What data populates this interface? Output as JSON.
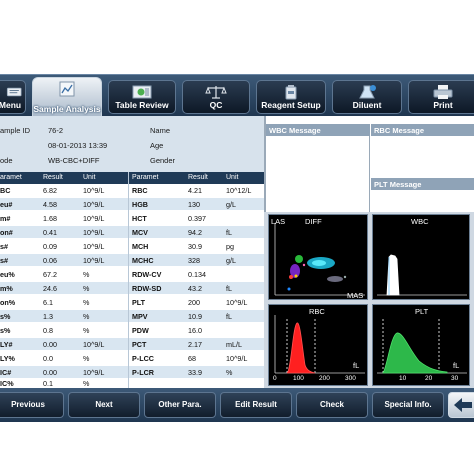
{
  "toolbar": {
    "menu": "Menu",
    "sample_analysis": "Sample Analysis",
    "table_review": "Table Review",
    "qc": "QC",
    "reagent_setup": "Reagent Setup",
    "diluent": "Diluent",
    "print": "Print"
  },
  "sample": {
    "id_label": "ample ID",
    "id_value": "76-2",
    "time_value": "08-01-2013 13:39",
    "mode_label": "ode",
    "mode_value": "WB-CBC+DIFF",
    "name_label": "Name",
    "age_label": "Age",
    "gender_label": "Gender"
  },
  "results": {
    "headers": [
      "aramet",
      "Result",
      "Unit",
      "Paramet",
      "Result",
      "Unit"
    ],
    "rows": [
      [
        "BC",
        "6.82",
        "10^9/L",
        "RBC",
        "4.21",
        "10^12/L"
      ],
      [
        "eu#",
        "4.58",
        "10^9/L",
        "HGB",
        "130",
        "g/L"
      ],
      [
        "m#",
        "1.68",
        "10^9/L",
        "HCT",
        "0.397",
        ""
      ],
      [
        "on#",
        "0.41",
        "10^9/L",
        "MCV",
        "94.2",
        "fL"
      ],
      [
        "s#",
        "0.09",
        "10^9/L",
        "MCH",
        "30.9",
        "pg"
      ],
      [
        "s#",
        "0.06",
        "10^9/L",
        "MCHC",
        "328",
        "g/L"
      ],
      [
        "eu%",
        "67.2",
        "%",
        "RDW-CV",
        "0.134",
        ""
      ],
      [
        "m%",
        "24.6",
        "%",
        "RDW-SD",
        "43.2",
        "fL"
      ],
      [
        "on%",
        "6.1",
        "%",
        "PLT",
        "200",
        "10^9/L"
      ],
      [
        "s%",
        "1.3",
        "%",
        "MPV",
        "10.9",
        "fL"
      ],
      [
        "s%",
        "0.8",
        "%",
        "PDW",
        "16.0",
        ""
      ],
      [
        "LY#",
        "0.00",
        "10^9/L",
        "PCT",
        "2.17",
        "mL/L"
      ],
      [
        "LY%",
        "0.0",
        "%",
        "P-LCC",
        "68",
        "10^9/L"
      ],
      [
        "IC#",
        "0.00",
        "10^9/L",
        "P-LCR",
        "33.9",
        "%"
      ],
      [
        "IC%",
        "0.1",
        "%",
        "",
        "",
        ""
      ]
    ]
  },
  "messages": {
    "wbc_title": "WBC Message",
    "rbc_title": "RBC Message",
    "plt_title": "PLT Message"
  },
  "plots": {
    "diff": {
      "title": "DIFF",
      "las": "LAS",
      "mas": "MAS"
    },
    "wbc": {
      "title": "WBC"
    },
    "rbc": {
      "title": "RBC",
      "unit": "fL",
      "ticks": [
        "0",
        "100",
        "200",
        "300"
      ]
    },
    "plt": {
      "title": "PLT",
      "unit": "fL",
      "ticks": [
        "10",
        "20",
        "30"
      ]
    }
  },
  "colors": {
    "rbc_curve": "#ff2020",
    "plt_curve": "#2db84a",
    "wbc_curve": "#ffffff"
  },
  "bottom": {
    "previous": "Previous",
    "next": "Next",
    "other_para": "Other Para.",
    "edit_result": "Edit Result",
    "check": "Check",
    "special_info": "Special Info."
  }
}
